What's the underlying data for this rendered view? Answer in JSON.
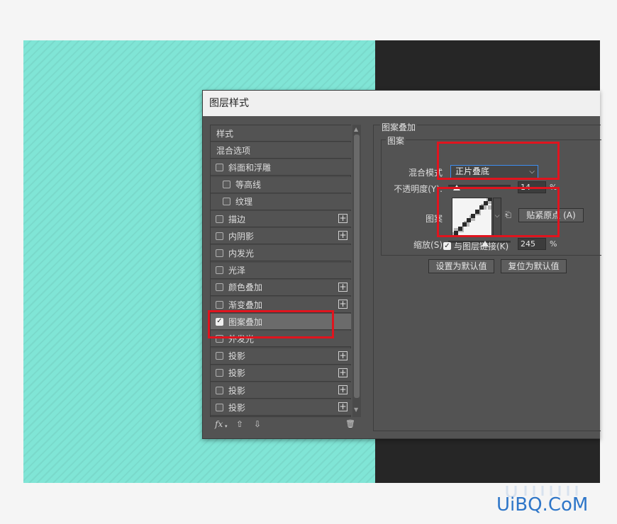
{
  "dialog": {
    "title": "图层样式"
  },
  "styles_list": {
    "items": [
      {
        "label": "样式",
        "checkbox": false,
        "checked": false,
        "plus": false,
        "indent": false,
        "selected": false
      },
      {
        "label": "混合选项",
        "checkbox": false,
        "checked": false,
        "plus": false,
        "indent": false,
        "selected": false
      },
      {
        "label": "斜面和浮雕",
        "checkbox": true,
        "checked": false,
        "plus": false,
        "indent": false,
        "selected": false
      },
      {
        "label": "等高线",
        "checkbox": true,
        "checked": false,
        "plus": false,
        "indent": true,
        "selected": false
      },
      {
        "label": "纹理",
        "checkbox": true,
        "checked": false,
        "plus": false,
        "indent": true,
        "selected": false
      },
      {
        "label": "描边",
        "checkbox": true,
        "checked": false,
        "plus": true,
        "indent": false,
        "selected": false
      },
      {
        "label": "内阴影",
        "checkbox": true,
        "checked": false,
        "plus": true,
        "indent": false,
        "selected": false
      },
      {
        "label": "内发光",
        "checkbox": true,
        "checked": false,
        "plus": false,
        "indent": false,
        "selected": false
      },
      {
        "label": "光泽",
        "checkbox": true,
        "checked": false,
        "plus": false,
        "indent": false,
        "selected": false
      },
      {
        "label": "颜色叠加",
        "checkbox": true,
        "checked": false,
        "plus": true,
        "indent": false,
        "selected": false
      },
      {
        "label": "渐变叠加",
        "checkbox": true,
        "checked": false,
        "plus": true,
        "indent": false,
        "selected": false
      },
      {
        "label": "图案叠加",
        "checkbox": true,
        "checked": true,
        "plus": false,
        "indent": false,
        "selected": true
      },
      {
        "label": "外发光",
        "checkbox": true,
        "checked": false,
        "plus": false,
        "indent": false,
        "selected": false
      },
      {
        "label": "投影",
        "checkbox": true,
        "checked": false,
        "plus": true,
        "indent": false,
        "selected": false
      },
      {
        "label": "投影",
        "checkbox": true,
        "checked": false,
        "plus": true,
        "indent": false,
        "selected": false
      },
      {
        "label": "投影",
        "checkbox": true,
        "checked": false,
        "plus": true,
        "indent": false,
        "selected": false
      },
      {
        "label": "投影",
        "checkbox": true,
        "checked": false,
        "plus": true,
        "indent": false,
        "selected": false
      }
    ],
    "tools": {
      "fx": "fx",
      "fx_menu": "▾",
      "up": "⇧",
      "down": "⇩",
      "trash": "🗑"
    }
  },
  "pattern_overlay": {
    "section_title": "图案叠加",
    "group_title": "图案",
    "blend_mode_label": "混合模式",
    "blend_mode_value": "正片叠底",
    "opacity_label": "不透明度(Y):",
    "opacity_value": "14",
    "opacity_level": 14,
    "percent": "%",
    "pattern_label": "图案",
    "snap_button": "贴紧原点 (A)",
    "scale_label": "缩放(S)",
    "scale_value": "245",
    "scale_level": 0.59,
    "link_label": "与图层链接(K)",
    "link_checked": true,
    "set_default_button": "设置为默认值",
    "reset_default_button": "复位为默认值"
  },
  "icons": {
    "dropdown": "chevron-down-icon",
    "new_preset": "new-preset-icon"
  },
  "colors": {
    "canvas_teal": "#80e5d6",
    "highlight_red": "#e0141e",
    "focus_blue": "#3d8ef0"
  },
  "watermark": {
    "text": "UiBQ.CoM"
  }
}
